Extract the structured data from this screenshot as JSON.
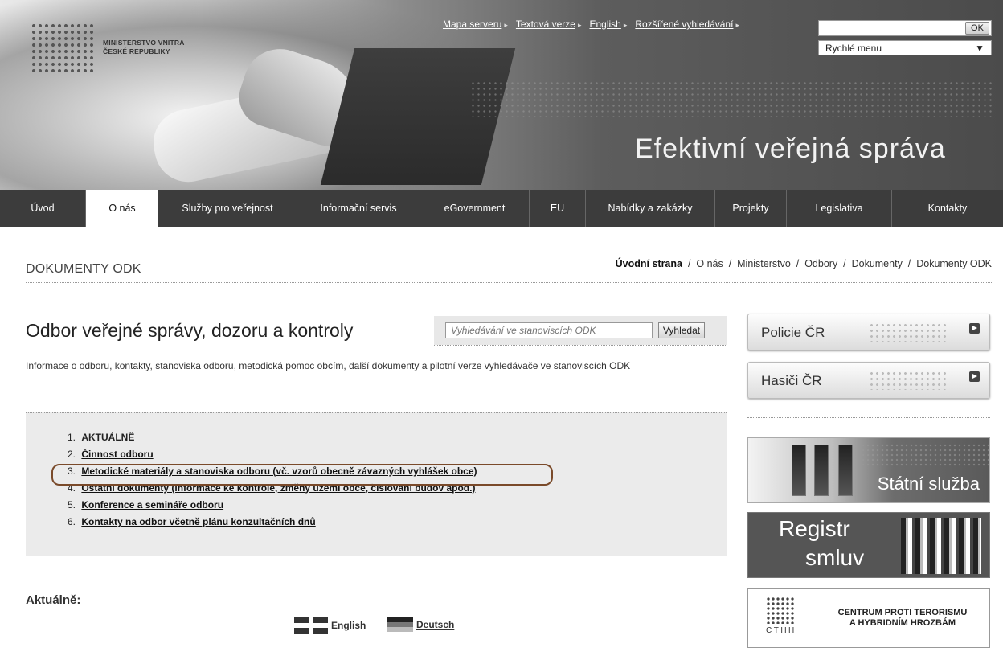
{
  "header": {
    "logo_line1": "MINISTERSTVO VNITRA",
    "logo_line2": "ČESKÉ REPUBLIKY",
    "tagline": "Efektivní veřejná správa",
    "top_links": [
      {
        "label": "Mapa serveru"
      },
      {
        "label": "Textová verze"
      },
      {
        "label": "English"
      },
      {
        "label": "Rozšířené vyhledávání"
      }
    ],
    "search": {
      "value": "",
      "ok_label": "OK"
    },
    "quick_menu": {
      "label": "Rychlé menu"
    }
  },
  "nav": [
    {
      "label": "Úvod"
    },
    {
      "label": "O nás"
    },
    {
      "label": "Služby pro veřejnost"
    },
    {
      "label": "Informační servis"
    },
    {
      "label": "eGovernment"
    },
    {
      "label": "EU"
    },
    {
      "label": "Nabídky a zakázky"
    },
    {
      "label": "Projekty"
    },
    {
      "label": "Legislativa"
    },
    {
      "label": "Kontakty"
    }
  ],
  "page": {
    "title": "DOKUMENTY ODK",
    "breadcrumb": [
      "Úvodní strana",
      "O nás",
      "Ministerstvo",
      "Odbory",
      "Dokumenty",
      "Dokumenty ODK"
    ],
    "breadcrumb_sep": "/"
  },
  "main": {
    "heading": "Odbor veřejné správy, dozoru a kontroly",
    "odk_search": {
      "placeholder": "Vyhledávání ve stanoviscích ODK",
      "button": "Vyhledat"
    },
    "description": "Informace o odboru, kontakty, stanoviska odboru, metodická pomoc obcím, další dokumenty a pilotní verze vyhledávače ve stanoviscích ODK",
    "list": [
      {
        "num": "1.",
        "label": "AKTUÁLNĚ"
      },
      {
        "num": "2.",
        "label": "Činnost odboru"
      },
      {
        "num": "3.",
        "label": "Metodické materiály a stanoviska odboru (vč. vzorů obecně závazných vyhlášek obce)"
      },
      {
        "num": "4.",
        "label": "Ostatní dokumenty (informace ke kontrole, změny území obce, číslování budov apod.)"
      },
      {
        "num": "5.",
        "label": "Konference a semináře odboru"
      },
      {
        "num": "6.",
        "label": "Kontakty na odbor včetně plánu konzultačních dnů"
      }
    ],
    "aktualne_heading": "Aktuálně:",
    "languages": [
      {
        "label": "English"
      },
      {
        "label": "Deutsch"
      }
    ]
  },
  "sidebar": {
    "buttons": [
      {
        "label": "Policie ČR"
      },
      {
        "label": "Hasiči ČR"
      }
    ],
    "statni_sluzba": "Státní služba",
    "registr_line1": "Registr",
    "registr_line2": "smluv",
    "cthh_abbr": "CTHH",
    "cthh_line1": "CENTRUM PROTI TERORISMU",
    "cthh_line2": "A HYBRIDNÍM HROZBÁM"
  }
}
